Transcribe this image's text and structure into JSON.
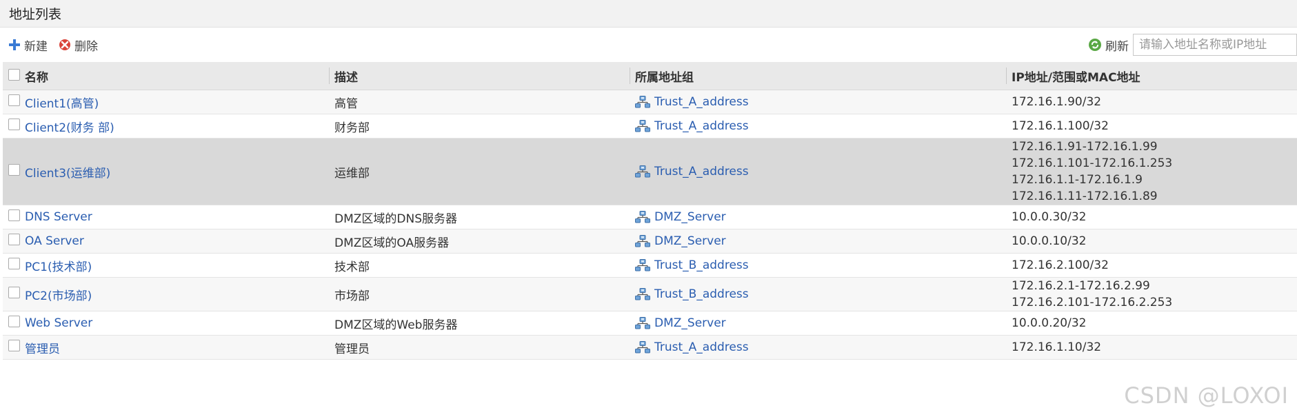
{
  "page": {
    "title": "地址列表"
  },
  "toolbar": {
    "new_label": "新建",
    "delete_label": "删除",
    "refresh_label": "刷新",
    "search_placeholder": "请输入地址名称或IP地址"
  },
  "table": {
    "headers": {
      "name": "名称",
      "description": "描述",
      "group": "所属地址组",
      "ip": "IP地址/范围或MAC地址"
    },
    "rows": [
      {
        "name": "Client1(高管)",
        "description": "高管",
        "group": "Trust_A_address",
        "ips": [
          "172.16.1.90/32"
        ]
      },
      {
        "name": "Client2(财务 部)",
        "description": "财务部",
        "group": "Trust_A_address",
        "ips": [
          "172.16.1.100/32"
        ]
      },
      {
        "name": "Client3(运维部)",
        "description": "运维部",
        "group": "Trust_A_address",
        "ips": [
          "172.16.1.91-172.16.1.99",
          "172.16.1.101-172.16.1.253",
          "172.16.1.1-172.16.1.9",
          "172.16.1.11-172.16.1.89"
        ]
      },
      {
        "name": "DNS Server",
        "description": "DMZ区域的DNS服务器",
        "group": "DMZ_Server",
        "ips": [
          "10.0.0.30/32"
        ]
      },
      {
        "name": "OA Server",
        "description": "DMZ区域的OA服务器",
        "group": "DMZ_Server",
        "ips": [
          "10.0.0.10/32"
        ]
      },
      {
        "name": "PC1(技术部)",
        "description": "技术部",
        "group": "Trust_B_address",
        "ips": [
          "172.16.2.100/32"
        ]
      },
      {
        "name": "PC2(市场部)",
        "description": "市场部",
        "group": "Trust_B_address",
        "ips": [
          "172.16.2.1-172.16.2.99",
          "172.16.2.101-172.16.2.253"
        ]
      },
      {
        "name": "Web Server",
        "description": "DMZ区域的Web服务器",
        "group": "DMZ_Server",
        "ips": [
          "10.0.0.20/32"
        ]
      },
      {
        "name": "管理员",
        "description": "管理员",
        "group": "Trust_A_address",
        "ips": [
          "172.16.1.10/32"
        ]
      }
    ]
  },
  "watermark": "CSDN @LOXOI",
  "colors": {
    "link": "#2a5db0",
    "header_bg": "#e9e9e9",
    "selected_row_bg": "#d9d9d9",
    "add_icon": "#3a7bd5",
    "delete_icon": "#d9443a",
    "refresh_icon": "#5aa845"
  }
}
